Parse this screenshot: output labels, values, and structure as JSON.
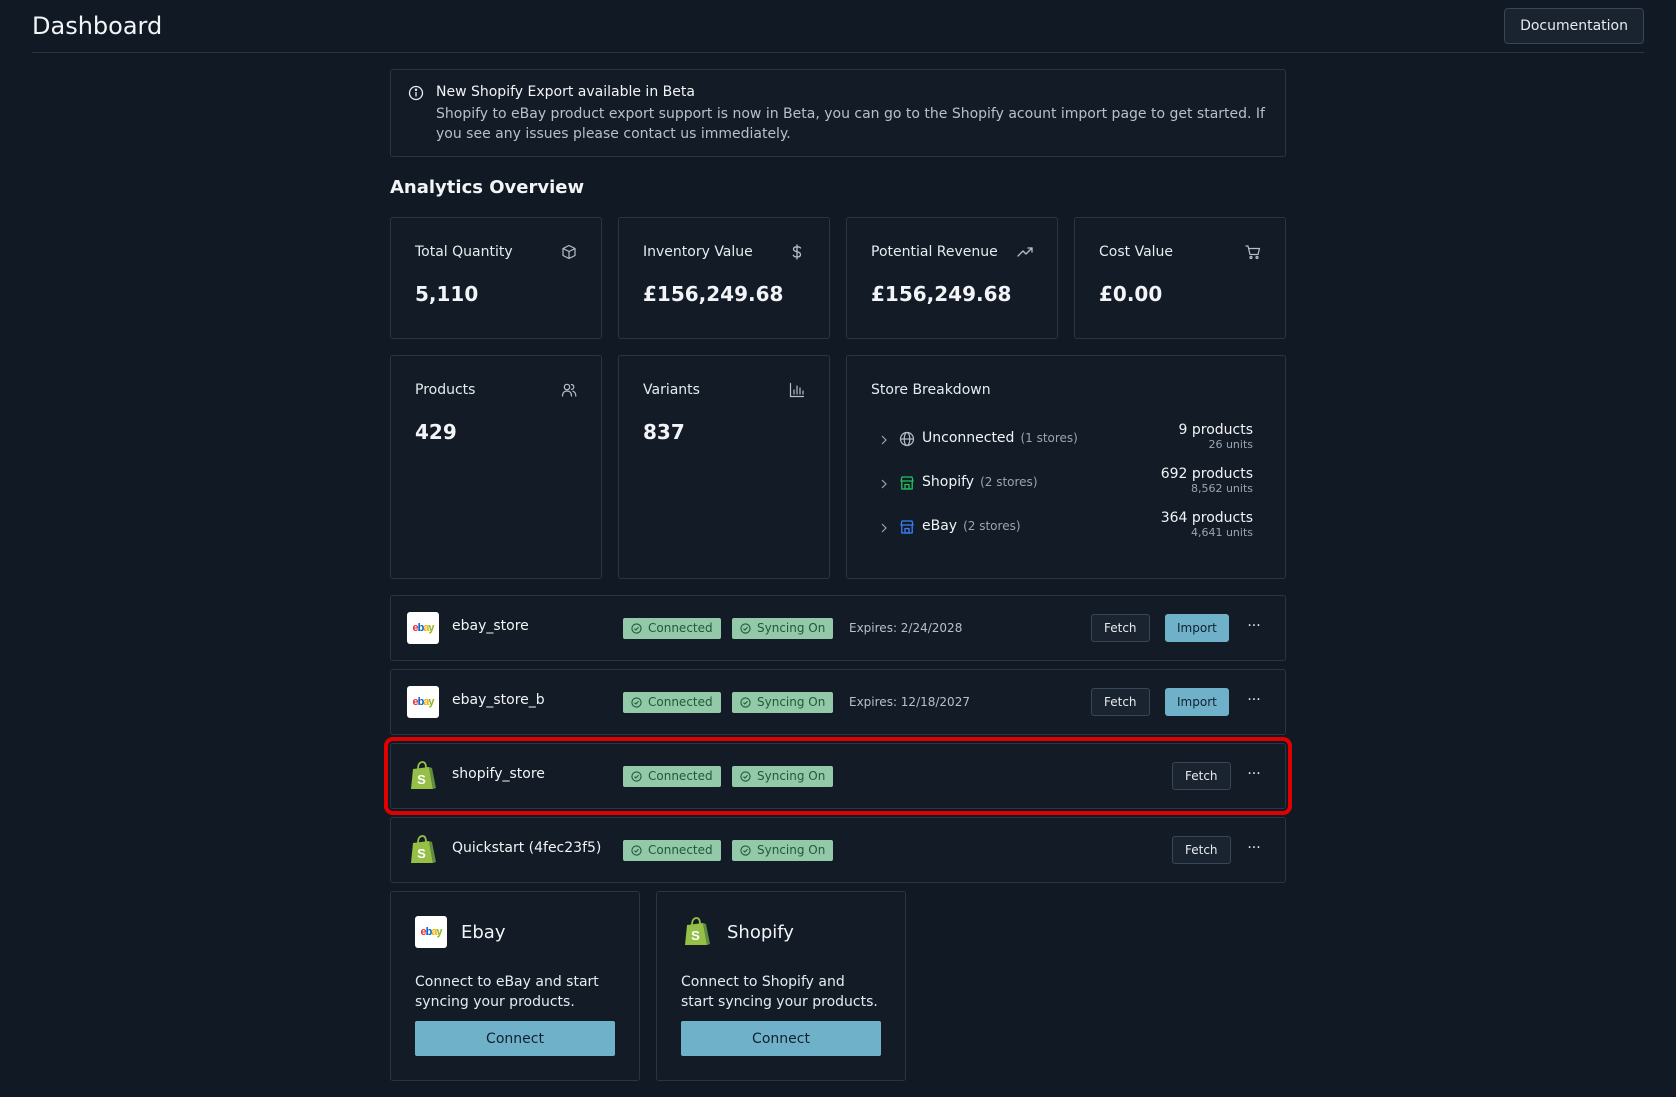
{
  "header": {
    "title": "Dashboard",
    "documentation_label": "Documentation"
  },
  "alert": {
    "title": "New Shopify Export available in Beta",
    "body": "Shopify to eBay product export support is now in Beta, you can go to the Shopify acount import page to get started. If you see any issues please contact us immediately."
  },
  "analytics": {
    "title": "Analytics Overview",
    "cards": [
      {
        "label": "Total Quantity",
        "value": "5,110",
        "icon": "box-icon"
      },
      {
        "label": "Inventory Value",
        "value": "£156,249.68",
        "icon": "dollar-icon"
      },
      {
        "label": "Potential Revenue",
        "value": "£156,249.68",
        "icon": "trend-up-icon"
      },
      {
        "label": "Cost Value",
        "value": "£0.00",
        "icon": "cart-icon"
      },
      {
        "label": "Products",
        "value": "429",
        "icon": "users-icon"
      },
      {
        "label": "Variants",
        "value": "837",
        "icon": "bar-chart-icon"
      }
    ],
    "breakdown": {
      "title": "Store Breakdown",
      "rows": [
        {
          "name": "Unconnected",
          "count": "(1 stores)",
          "products": "9 products",
          "units": "26 units",
          "icon": "globe-icon"
        },
        {
          "name": "Shopify",
          "count": "(2 stores)",
          "products": "692 products",
          "units": "8,562 units",
          "icon": "store-icon"
        },
        {
          "name": "eBay",
          "count": "(2 stores)",
          "products": "364 products",
          "units": "4,641 units",
          "icon": "store-icon"
        }
      ]
    }
  },
  "stores": [
    {
      "name": "ebay_store",
      "platform": "ebay",
      "connected": "Connected",
      "syncing": "Syncing On",
      "expires": "Expires: 2/24/2028",
      "fetch": "Fetch",
      "import": "Import",
      "more": "···"
    },
    {
      "name": "ebay_store_b",
      "platform": "ebay",
      "connected": "Connected",
      "syncing": "Syncing On",
      "expires": "Expires: 12/18/2027",
      "fetch": "Fetch",
      "import": "Import",
      "more": "···"
    },
    {
      "name": "shopify_store",
      "platform": "shopify",
      "connected": "Connected",
      "syncing": "Syncing On",
      "fetch": "Fetch",
      "more": "···"
    },
    {
      "name": "Quickstart (4fec23f5)",
      "platform": "shopify",
      "connected": "Connected",
      "syncing": "Syncing On",
      "fetch": "Fetch",
      "more": "···"
    }
  ],
  "connect": [
    {
      "title": "Ebay",
      "description": "Connect to eBay and start syncing your products.",
      "button": "Connect",
      "logo_text": "ebay"
    },
    {
      "title": "Shopify",
      "description": "Connect to Shopify and start syncing your products.",
      "button": "Connect"
    }
  ],
  "colors": {
    "background": "#111a24",
    "accent": "#6fb1c8",
    "badge_bg": "#93c9a8",
    "badge_text": "#1f5a36",
    "highlight": "#e00000",
    "shopify_green": "#95bf47",
    "store_shopify": "#22c55e",
    "store_ebay": "#3b82f6"
  }
}
